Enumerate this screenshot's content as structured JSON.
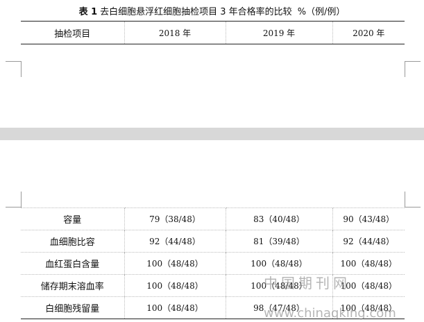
{
  "title": {
    "number": "表 1",
    "text": "去白细胞悬浮红细胞抽检项目 3 年合格率的比较",
    "unit": "%（例/例）"
  },
  "table": {
    "headers": [
      "抽检项目",
      "2018 年",
      "2019 年",
      "2020 年"
    ],
    "rows": [
      [
        "容量",
        "79（38/48）",
        "83（40/48）",
        "90（43/48）"
      ],
      [
        "血细胞比容",
        "92（44/48）",
        "81（39/48）",
        "92（44/48）"
      ],
      [
        "血红蛋白含量",
        "100（48/48）",
        "100（48/48）",
        "100（48/48）"
      ],
      [
        "储存期末溶血率",
        "100（48/48）",
        "100（48/48）",
        "100（48/48）"
      ],
      [
        "白细胞残留量",
        "100（48/48）",
        "98（47/48）",
        "100（48/48）"
      ]
    ]
  },
  "watermark": {
    "line1": "中国期刊网",
    "line2": "www.chinaqking.com"
  }
}
